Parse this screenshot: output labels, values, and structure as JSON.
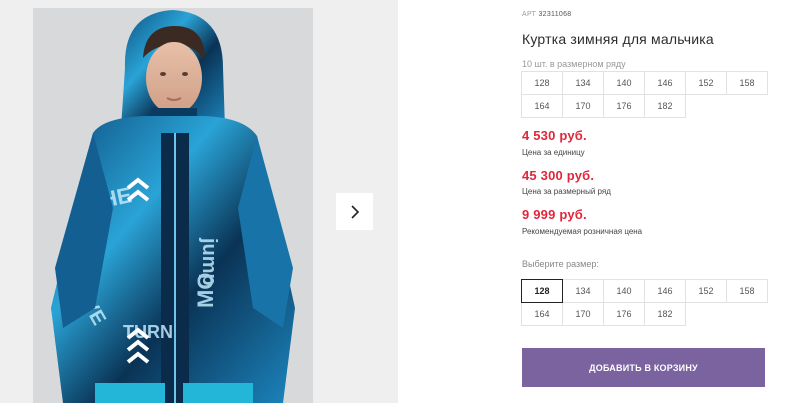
{
  "product": {
    "article_prefix": "АРТ",
    "article_number": "32311068",
    "title": "Куртка зимняя для мальчика",
    "image_alt": "Boy wearing a blue printed winter jacket with hood"
  },
  "size_row": {
    "caption": "10 шт. в размерном ряду",
    "sizes": [
      "128",
      "134",
      "140",
      "146",
      "152",
      "158",
      "164",
      "170",
      "176",
      "182"
    ]
  },
  "prices": {
    "unit_price": "4 530 руб.",
    "unit_label": "Цена за единицу",
    "row_price": "45 300 руб.",
    "row_label": "Цена за размерный ряд",
    "rrp_price": "9 999 руб.",
    "rrp_label": "Рекомендуемая розничная цена"
  },
  "size_picker": {
    "caption": "Выберите размер:",
    "sizes": [
      "128",
      "134",
      "140",
      "146",
      "152",
      "158",
      "164",
      "170",
      "176",
      "182"
    ],
    "selected": "128"
  },
  "cart": {
    "button_label": "ДОБАВИТЬ В КОРЗИНУ"
  },
  "colors": {
    "price": "#e0263a",
    "button": "#7b639f",
    "jacket_blue": "#1f6fa8"
  },
  "icons": {
    "next": "chevron-right-icon"
  }
}
